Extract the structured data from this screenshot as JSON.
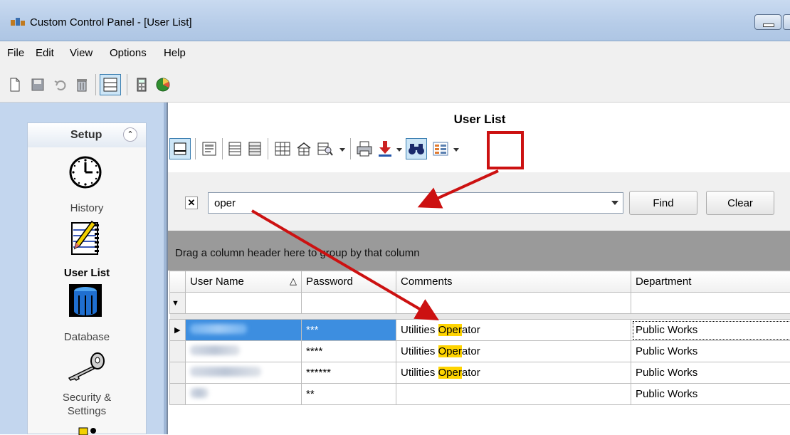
{
  "window": {
    "title": "Custom Control Panel - [User List]"
  },
  "menu": {
    "file": "File",
    "edit": "Edit",
    "view": "View",
    "options": "Options",
    "help": "Help"
  },
  "nav": {
    "header": "Setup",
    "items": [
      {
        "label": "History",
        "icon": "clock-icon"
      },
      {
        "label": "User List",
        "icon": "notepad-icon",
        "active": true
      },
      {
        "label": "Database",
        "icon": "database-icon"
      },
      {
        "label": "Security & Settings",
        "icon": "key-icon"
      }
    ]
  },
  "panel": {
    "title": "User List"
  },
  "find": {
    "value": "oper",
    "find_label": "Find",
    "clear_label": "Clear"
  },
  "group": {
    "text": "Drag a column header here to group by that column"
  },
  "table": {
    "columns": [
      "User Name",
      "Password",
      "Comments",
      "Department"
    ],
    "rows": [
      {
        "password": "***",
        "comment_pre": "Utilities ",
        "comment_hl": "Oper",
        "comment_post": "ator",
        "department": "Public Works"
      },
      {
        "password": "****",
        "comment_pre": "Utilities ",
        "comment_hl": "Oper",
        "comment_post": "ator",
        "department": "Public Works"
      },
      {
        "password": "******",
        "comment_pre": "Utilities ",
        "comment_hl": "Oper",
        "comment_post": "ator",
        "department": "Public Works"
      },
      {
        "password": "**",
        "comment_pre": "",
        "comment_hl": "",
        "comment_post": "",
        "department": "Public Works"
      }
    ]
  },
  "colors": {
    "highlight": "#ffd400",
    "annotation": "#cc1111"
  }
}
